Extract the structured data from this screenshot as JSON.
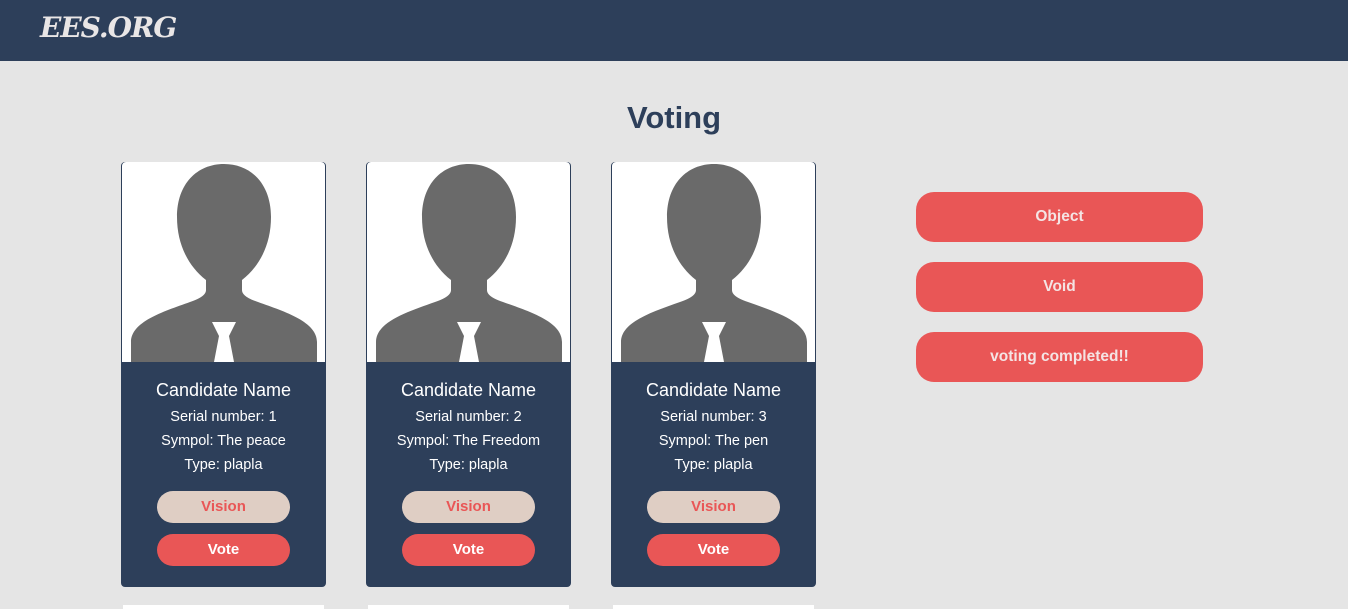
{
  "brand": "EES.ORG",
  "page_title": "Voting",
  "candidates": [
    {
      "name": "Candidate Name",
      "serial": "Serial number: 1",
      "symbol": "Sympol: The peace",
      "type": "Type: plapla",
      "vision_label": "Vision",
      "vote_label": "Vote"
    },
    {
      "name": "Candidate Name",
      "serial": "Serial number: 2",
      "symbol": "Sympol: The Freedom",
      "type": "Type: plapla",
      "vision_label": "Vision",
      "vote_label": "Vote"
    },
    {
      "name": "Candidate Name",
      "serial": "Serial number: 3",
      "symbol": "Sympol: The pen",
      "type": "Type: plapla",
      "vision_label": "Vision",
      "vote_label": "Vote"
    }
  ],
  "actions": {
    "object_label": "Object",
    "void_label": "Void",
    "completed_label": "voting completed!!"
  },
  "colors": {
    "navbar": "#2d3f5a",
    "accent": "#e95656",
    "vision_button": "#dfcec4",
    "background": "#e5e5e5"
  },
  "icons": [
    "person-silhouette-icon"
  ]
}
